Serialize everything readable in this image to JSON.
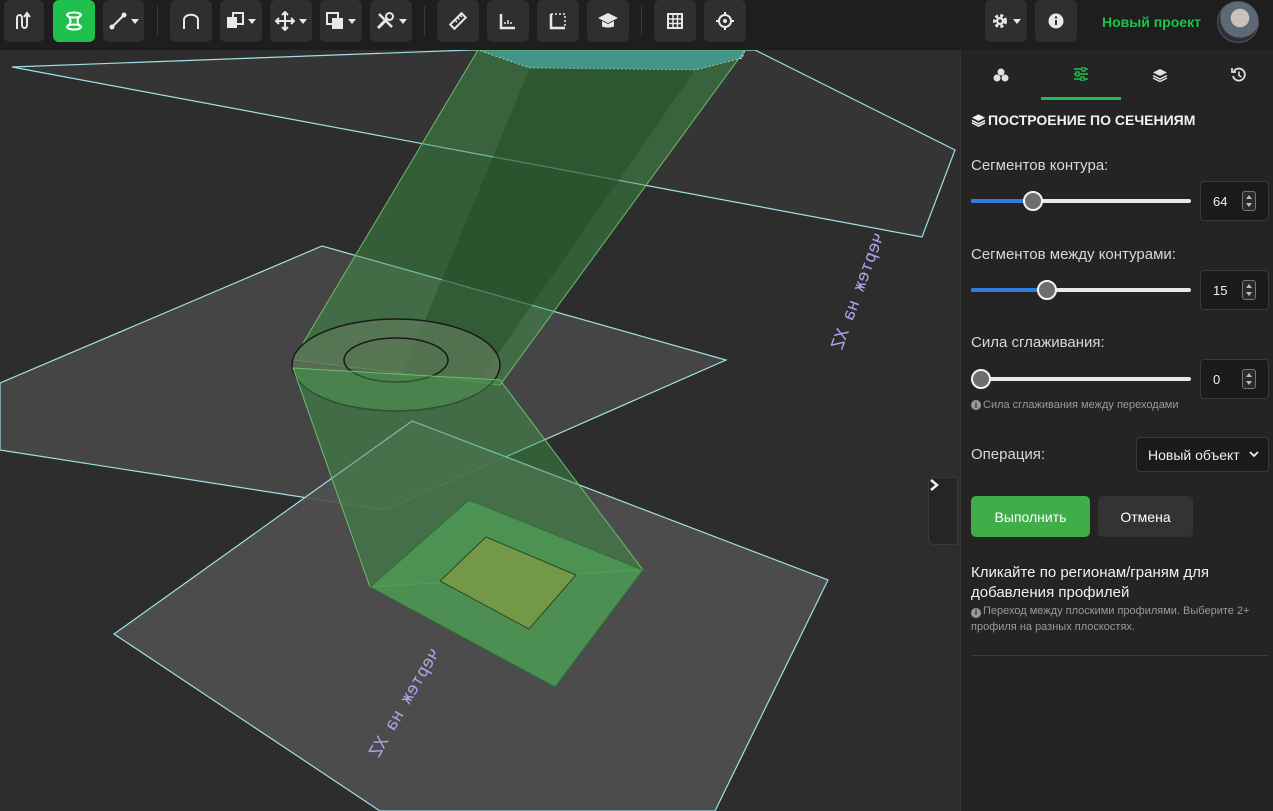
{
  "header": {
    "project_name": "Новый проект"
  },
  "toolbar": {
    "icons": [
      "loft-icon",
      "section-loft-icon",
      "sketch-tools-icon",
      "arc-icon",
      "boolean-icon",
      "move-icon",
      "copy-icon",
      "tools-icon",
      "ruler-icon",
      "dimension-icon",
      "frame-icon",
      "tutorial-icon",
      "grid-icon",
      "target-icon",
      "settings-icon",
      "info-icon"
    ],
    "active_tool": "section-loft-icon"
  },
  "viewport": {
    "sketch_label_top": "чертеж на XZ",
    "sketch_label_bottom": "чертеж на XZ"
  },
  "panel": {
    "tabs": [
      "shapes-icon",
      "sliders-icon",
      "layers-icon",
      "history-icon"
    ],
    "active_tab": "sliders-icon",
    "section_title": "ПОСТРОЕНИЕ ПО СЕЧЕНИЯМ",
    "contour_segments": {
      "label": "Сегментов контура:",
      "value": "64",
      "fraction": 0.26
    },
    "between_segments": {
      "label": "Сегментов между контурами:",
      "value": "15",
      "fraction": 0.33
    },
    "smoothing": {
      "label": "Сила сглаживания:",
      "value": "0",
      "fraction": 0.0,
      "hint": "Сила сглаживания между переходами"
    },
    "operation": {
      "label": "Операция:",
      "value": "Новый объект"
    },
    "execute_label": "Выполнить",
    "cancel_label": "Отмена",
    "help_title": "Кликайте по регионам/граням для добавления профилей",
    "help_desc": "Переход между плоскими профилями. Выберите 2+ профиля на разных плоскостях."
  },
  "colors": {
    "accent": "#1fc14e",
    "primary_button": "#3fae49",
    "slider_fill": "#2f7de1",
    "plane_outline": "#9fe0e4",
    "loft_fill": "#3f9b47",
    "sketch_label": "#a9a4e8"
  }
}
